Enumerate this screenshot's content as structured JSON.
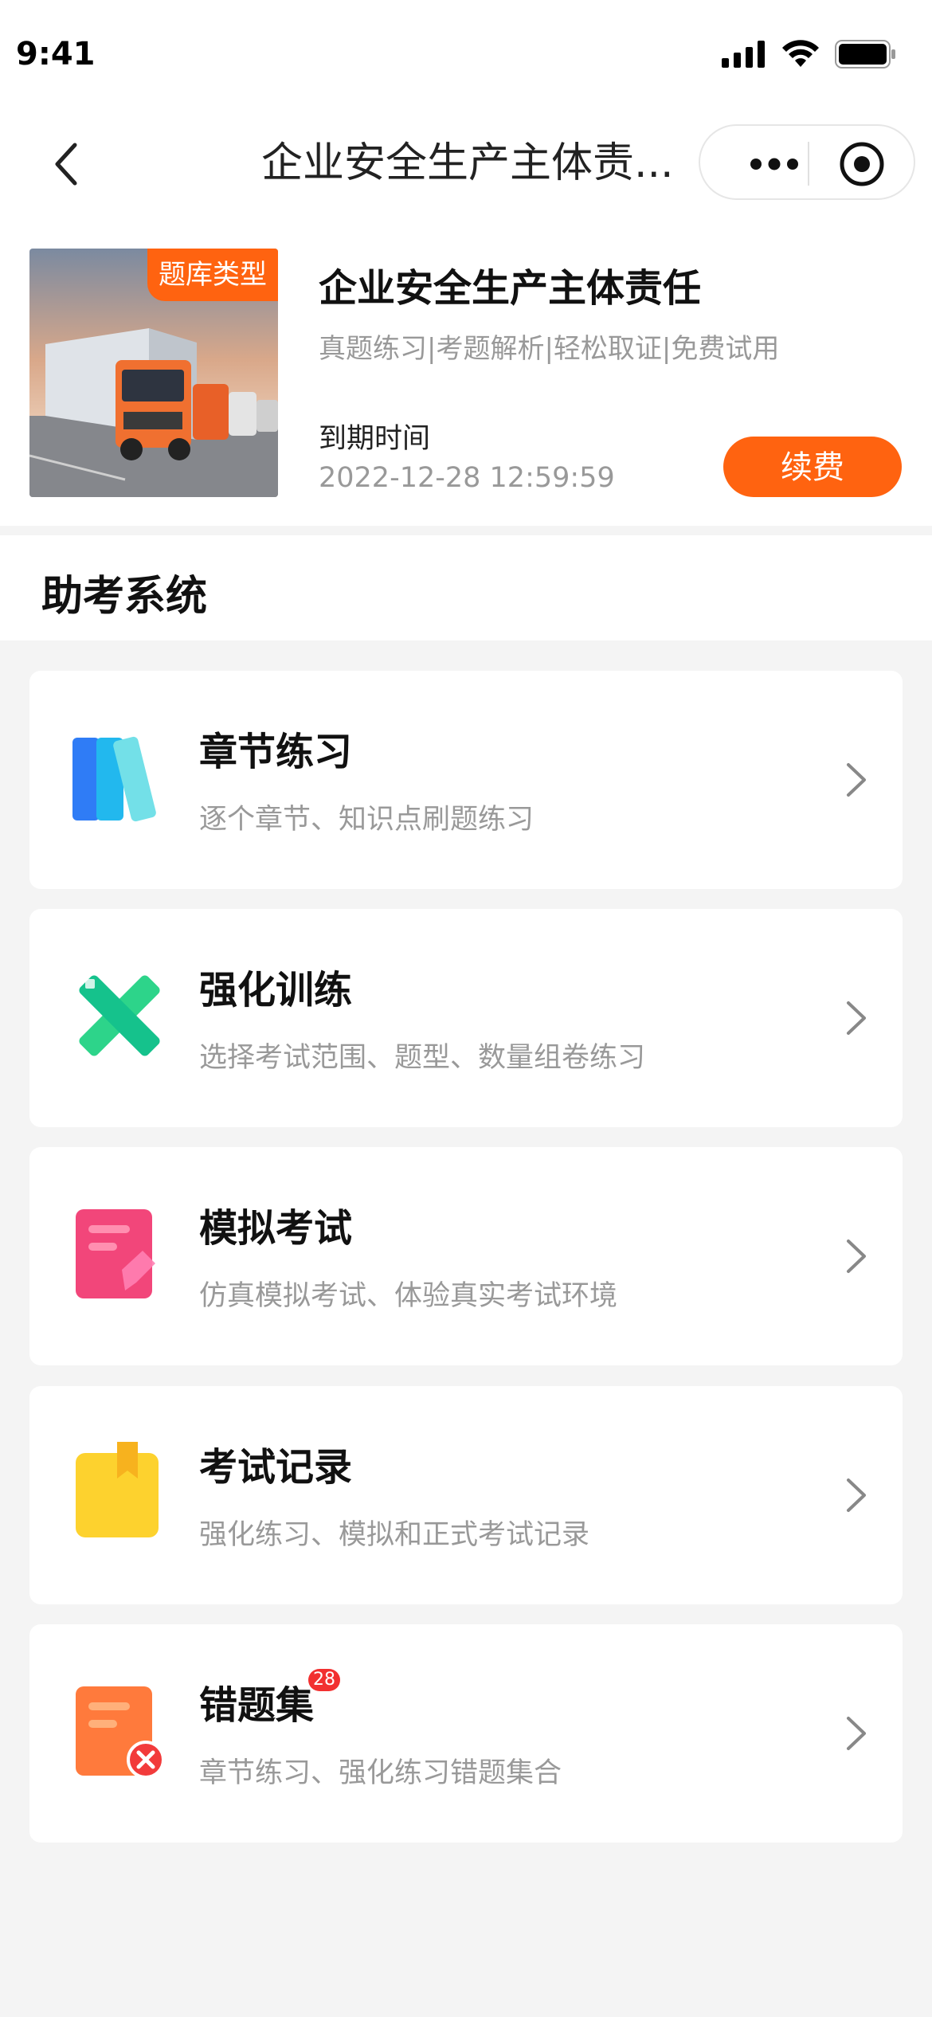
{
  "status": {
    "time": "9:41"
  },
  "nav": {
    "title": "企业安全生产主体责..."
  },
  "course": {
    "tag": "题库类型",
    "title": "企业安全生产主体责任",
    "subtitle": "真题练习|考题解析|轻松取证|免费试用",
    "expire_label": "到期时间",
    "expire_date": "2022-12-28 12:59:59",
    "renew_label": "续费"
  },
  "section": {
    "title": "助考系统"
  },
  "menu": [
    {
      "title": "章节练习",
      "desc": "逐个章节、知识点刷题练习",
      "icon": "books-icon"
    },
    {
      "title": "强化训练",
      "desc": "选择考试范围、题型、数量组卷练习",
      "icon": "pencil-ruler-icon"
    },
    {
      "title": "模拟考试",
      "desc": "仿真模拟考试、体验真实考试环境",
      "icon": "exam-paper-icon"
    },
    {
      "title": "考试记录",
      "desc": "强化练习、模拟和正式考试记录",
      "icon": "bookmark-icon"
    },
    {
      "title": "错题集",
      "desc": "章节练习、强化练习错题集合",
      "icon": "wrong-answers-icon",
      "badge": "28"
    }
  ],
  "colors": {
    "accent": "#ff6310",
    "badge": "#f23030"
  }
}
